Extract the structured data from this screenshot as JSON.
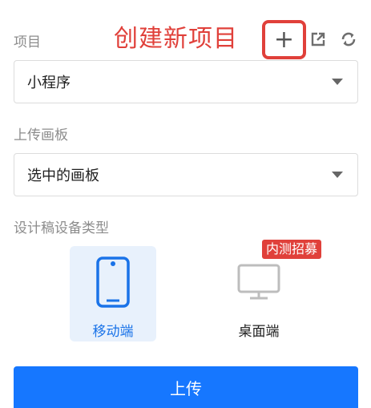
{
  "header": {
    "project_label": "项目",
    "annotation": "创建新项目",
    "add_button_glyph": "+",
    "icons": {
      "add": "plus-icon",
      "export": "external-link-icon",
      "refresh": "refresh-icon"
    }
  },
  "project_select": {
    "value": "小程序"
  },
  "upload_board": {
    "label": "上传画板",
    "value": "选中的画板"
  },
  "device_type": {
    "label": "设计稿设备类型",
    "options": [
      {
        "label": "移动端",
        "icon": "mobile-phone-icon",
        "selected": true
      },
      {
        "label": "桌面端",
        "icon": "desktop-monitor-icon",
        "selected": false
      }
    ],
    "beta_badge": "内测招募"
  },
  "footer": {
    "upload_label": "上传"
  },
  "colors": {
    "accent": "#1677ff",
    "highlight_red": "#e0403a",
    "selected_bg": "#e8f1fc",
    "muted_text": "#8c8c8c"
  }
}
